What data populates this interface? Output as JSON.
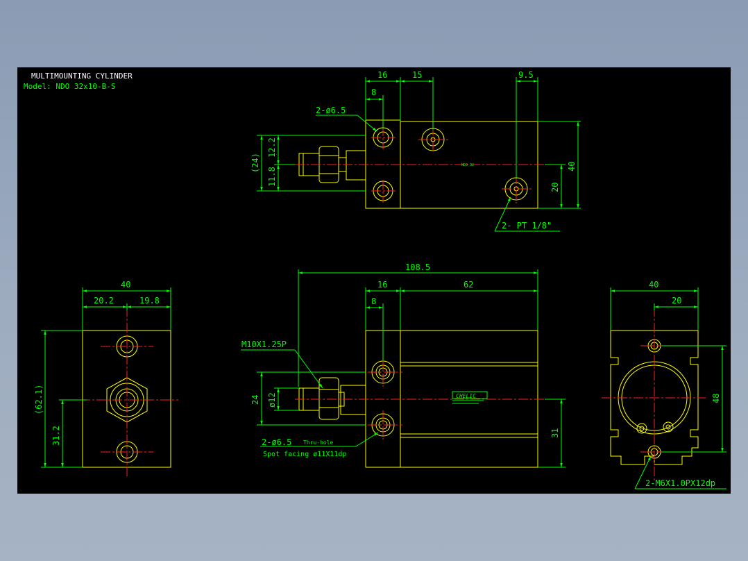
{
  "title": {
    "line1": "MULTIMOUNTING CYLINDER",
    "line2": "Model:  NDO  32x10-B-S"
  },
  "top_view": {
    "dim_16": "16",
    "dim_15": "15",
    "dim_9_5": "9.5",
    "dim_8": "8",
    "hole_label": "2-ø6.5",
    "dim_24": "(24)",
    "dim_12_2": "12.2",
    "dim_11_8": "11.8",
    "dim_40": "40",
    "dim_20": "20",
    "port_label": "2-  PT 1/8\"",
    "part_tag": "NDO 32"
  },
  "end_view_left": {
    "dim_40": "40",
    "dim_20_2": "20.2",
    "dim_19_8": "19.8",
    "dim_62_1": "(62.1)",
    "dim_31_2": "31.2"
  },
  "front_view": {
    "dim_108_5": "108.5",
    "dim_16": "16",
    "dim_62": "62",
    "dim_8": "8",
    "thread_label": "M10X1.25P",
    "dim_24": "24",
    "dim_12": "ø12",
    "dim_31": "31",
    "hole_label": "2-ø6.5",
    "hole_note": "Thru-hole",
    "spot_label": "Spot facing  ø11X11dp",
    "logo_text": "CHELIC"
  },
  "end_view_right": {
    "dim_40": "40",
    "dim_20": "20",
    "dim_48": "48",
    "tap_label": "2-M6X1.0PX12dp"
  }
}
